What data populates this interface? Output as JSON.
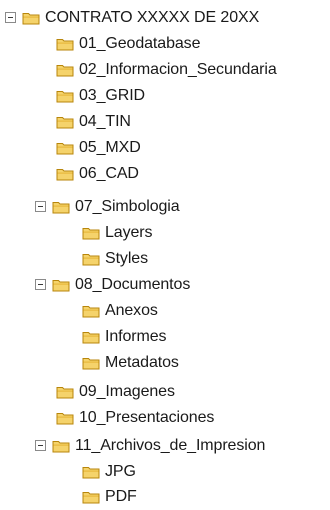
{
  "tree": {
    "root": {
      "label": "CONTRATO XXXXX DE 20XX",
      "expanded": true
    },
    "items": [
      {
        "label": "01_Geodatabase"
      },
      {
        "label": "02_Informacion_Secundaria"
      },
      {
        "label": "03_GRID"
      },
      {
        "label": "04_TIN"
      },
      {
        "label": "05_MXD"
      },
      {
        "label": "06_CAD"
      },
      {
        "label": "07_Simbologia",
        "expanded": true
      },
      {
        "label": "Layers"
      },
      {
        "label": "Styles"
      },
      {
        "label": "08_Documentos",
        "expanded": true
      },
      {
        "label": "Anexos"
      },
      {
        "label": "Informes"
      },
      {
        "label": "Metadatos"
      },
      {
        "label": "09_Imagenes"
      },
      {
        "label": "10_Presentaciones"
      },
      {
        "label": "11_Archivos_de_Impresion",
        "expanded": true
      },
      {
        "label": "JPG"
      },
      {
        "label": "PDF"
      }
    ]
  },
  "icons": {
    "folder": "folder-icon",
    "collapse": "collapse-minus-icon"
  },
  "colors": {
    "folder_fill": "#f5d36b",
    "folder_tab": "#e8b83c",
    "folder_stroke": "#b8860b",
    "toggle_border": "#8a8a8a"
  }
}
